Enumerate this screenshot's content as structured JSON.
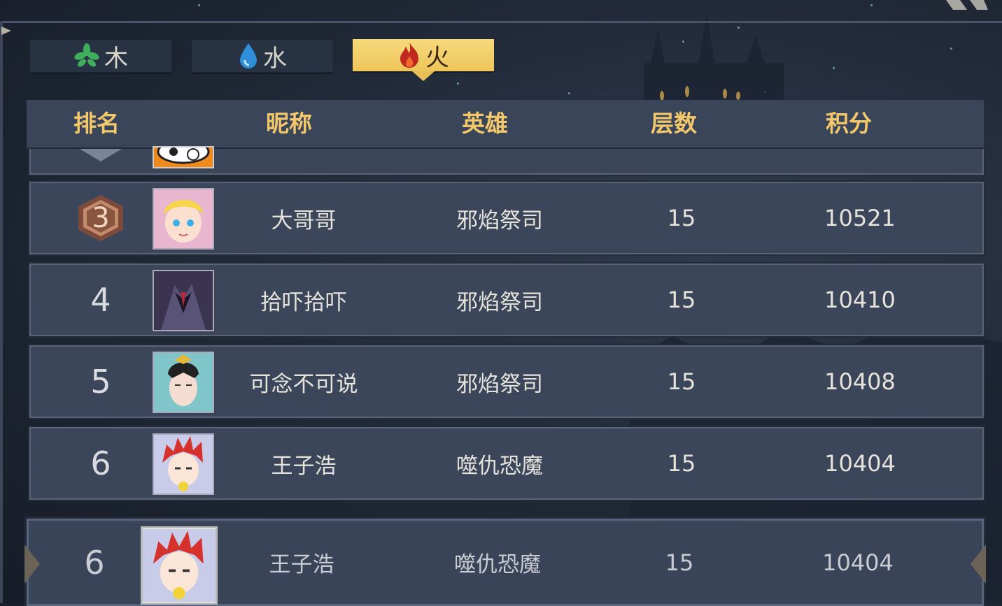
{
  "tabs": [
    {
      "label": "木",
      "icon": "leaf-icon",
      "active": false
    },
    {
      "label": "水",
      "icon": "water-drop-icon",
      "active": false
    },
    {
      "label": "火",
      "icon": "fire-icon",
      "active": true
    }
  ],
  "headers": {
    "rank": "排名",
    "nickname": "昵称",
    "hero": "英雄",
    "floors": "层数",
    "score": "积分"
  },
  "rows": [
    {
      "rank": "3",
      "nickname": "大哥哥",
      "hero": "邪焰祭司",
      "floors": "15",
      "score": "10521",
      "avatar": "blonde-boy-avatar"
    },
    {
      "rank": "4",
      "nickname": "拾吓拾吓",
      "hero": "邪焰祭司",
      "floors": "15",
      "score": "10410",
      "avatar": "dark-dragon-avatar"
    },
    {
      "rank": "5",
      "nickname": "可念不可说",
      "hero": "邪焰祭司",
      "floors": "15",
      "score": "10408",
      "avatar": "crowned-sage-avatar"
    },
    {
      "rank": "6",
      "nickname": "王子浩",
      "hero": "噬仇恐魔",
      "floors": "15",
      "score": "10404",
      "avatar": "red-spiky-hair-avatar"
    }
  ],
  "my_rank": {
    "rank": "6",
    "nickname": "王子浩",
    "hero": "噬仇恐魔",
    "floors": "15",
    "score": "10404",
    "avatar": "red-spiky-hair-avatar"
  },
  "colors": {
    "accent_gold": "#f3c86a",
    "tab_active": "#f2cc63",
    "row_bg": "#3b465a",
    "bronze_badge": "#a0705a"
  }
}
